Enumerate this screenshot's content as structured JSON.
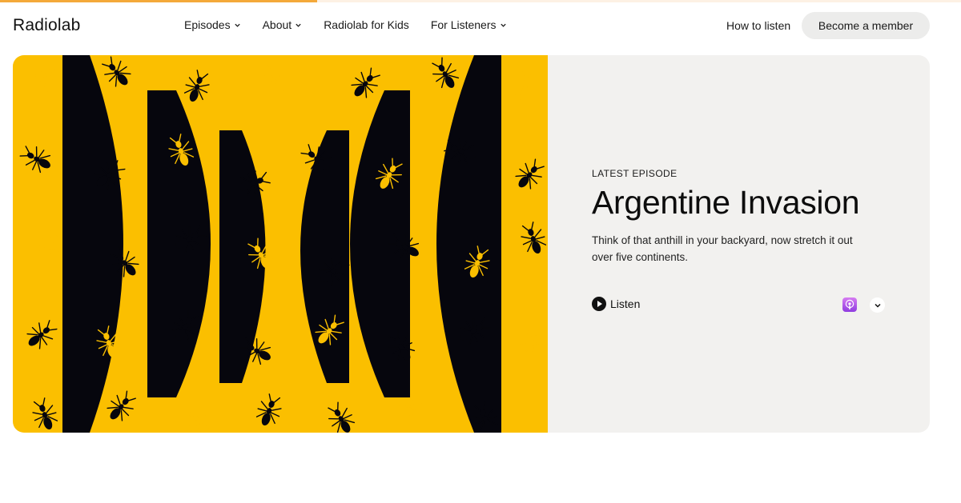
{
  "progress": {
    "fraction": 0.33
  },
  "header": {
    "logo": "Radiolab",
    "nav": [
      {
        "label": "Episodes",
        "dropdown": true
      },
      {
        "label": "About",
        "dropdown": true
      },
      {
        "label": "Radiolab for Kids",
        "dropdown": false
      },
      {
        "label": "For Listeners",
        "dropdown": true
      }
    ],
    "how_to_listen": "How to listen",
    "member_button": "Become a member"
  },
  "hero": {
    "eyebrow": "LATEST EPISODE",
    "title": "Argentine Invasion",
    "description": "Think of that anthill in your backyard, now stretch it out over five continents.",
    "listen_label": "Listen",
    "podcast_icon": "apple-podcasts-icon",
    "more_icon": "chevron-down-icon",
    "artwork": {
      "background": "#fbbf00",
      "foreground": "#06060d"
    }
  },
  "colors": {
    "accent": "#f4a93a",
    "panel": "#f2f1ef",
    "button": "#ececeb"
  }
}
